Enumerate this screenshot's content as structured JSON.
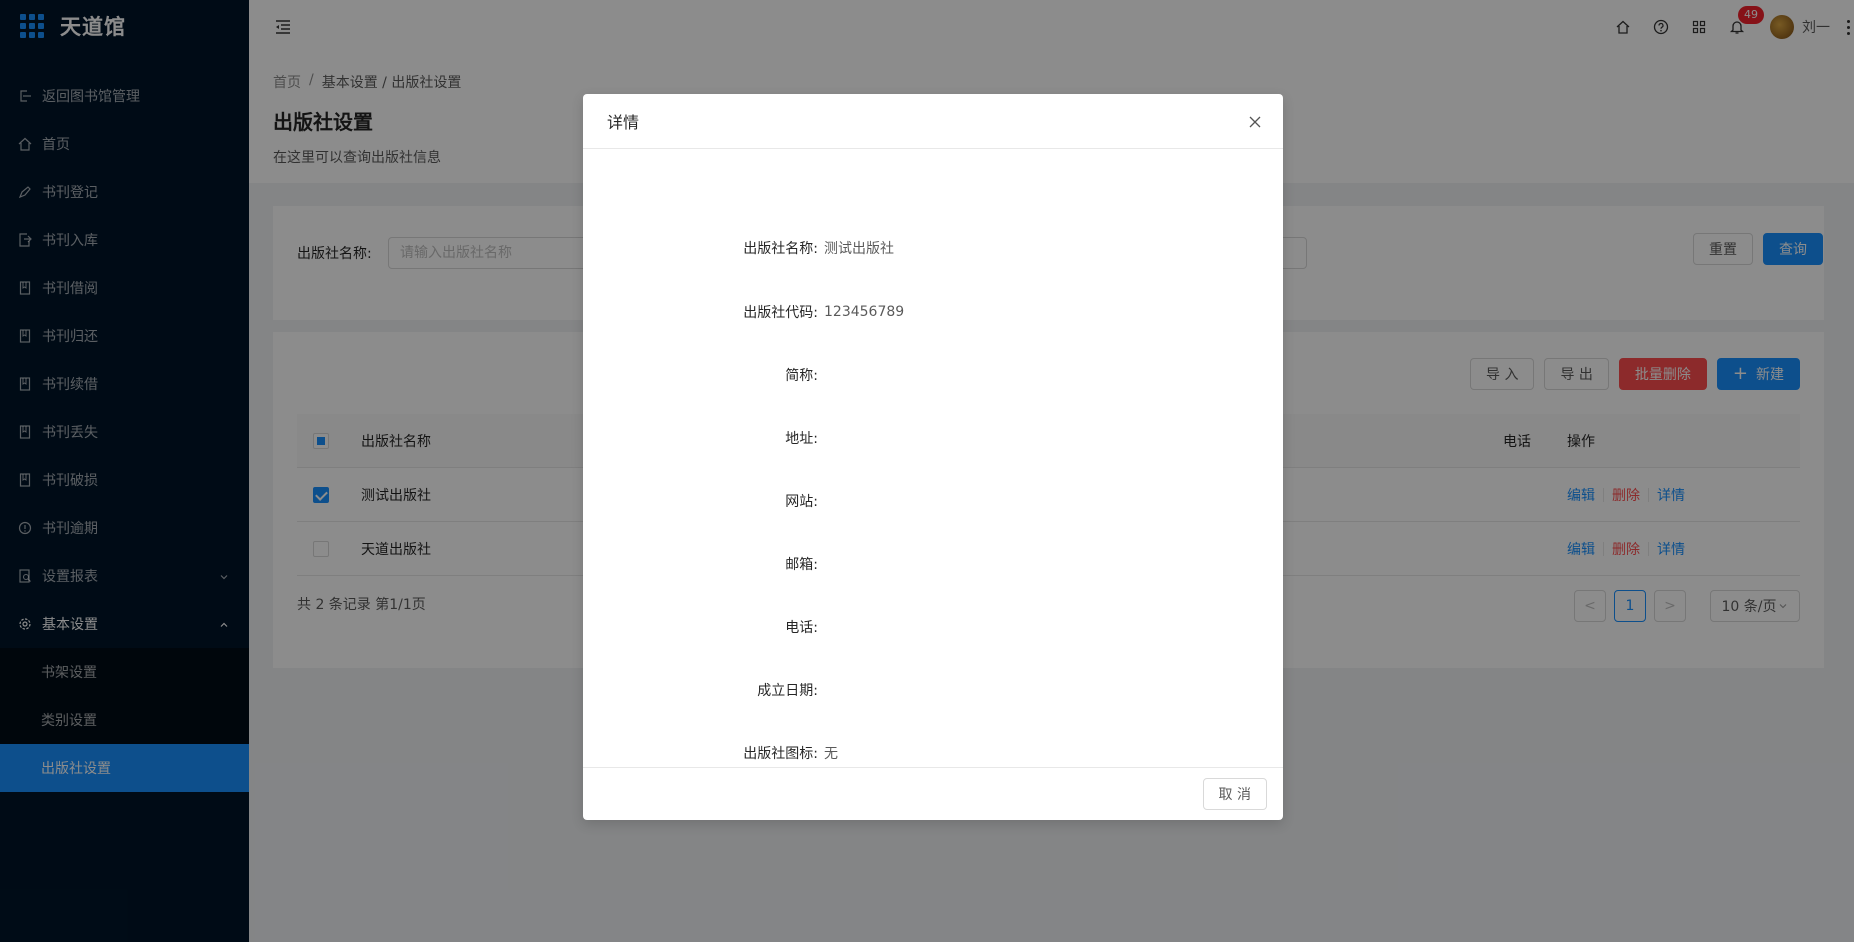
{
  "app": {
    "title": "天道馆"
  },
  "sidebar": {
    "items": [
      {
        "label": "返回图书馆管理",
        "icon": "return-icon"
      },
      {
        "label": "首页",
        "icon": "home-icon"
      },
      {
        "label": "书刊登记",
        "icon": "pen-icon"
      },
      {
        "label": "书刊入库",
        "icon": "import-icon"
      },
      {
        "label": "书刊借阅",
        "icon": "book-icon"
      },
      {
        "label": "书刊归还",
        "icon": "book-icon"
      },
      {
        "label": "书刊续借",
        "icon": "book-icon"
      },
      {
        "label": "书刊丢失",
        "icon": "book-icon"
      },
      {
        "label": "书刊破损",
        "icon": "book-icon"
      },
      {
        "label": "书刊逾期",
        "icon": "clock-icon"
      },
      {
        "label": "设置报表",
        "icon": "report-icon"
      },
      {
        "label": "基本设置",
        "icon": "gear-icon"
      }
    ],
    "submenu": [
      {
        "label": "书架设置"
      },
      {
        "label": "类别设置"
      },
      {
        "label": "出版社设置"
      }
    ]
  },
  "header": {
    "notification_count": "49",
    "user_name": "刘一"
  },
  "breadcrumb": {
    "home": "首页",
    "sep": "/",
    "current": "基本设置 / 出版社设置"
  },
  "page": {
    "title": "出版社设置",
    "description": "在这里可以查询出版社信息"
  },
  "search": {
    "label": "出版社名称:",
    "placeholder": "请输入出版社名称",
    "reset_label": "重置",
    "query_label": "查询"
  },
  "toolbar": {
    "import_label": "导 入",
    "export_label": "导 出",
    "batch_delete_label": "批量删除",
    "new_label": "新建"
  },
  "table": {
    "columns": {
      "name": "出版社名称",
      "phone": "电话",
      "ops": "操作"
    },
    "rows": [
      {
        "name": "测试出版社",
        "checked": true
      },
      {
        "name": "天道出版社",
        "checked": false
      }
    ],
    "actions": {
      "edit": "编辑",
      "delete": "删除",
      "detail": "详情"
    }
  },
  "pagination": {
    "total_text": "共 2 条记录 第1/1页",
    "prev": "<",
    "current": "1",
    "next": ">",
    "page_size": "10 条/页"
  },
  "modal": {
    "title": "详情",
    "fields": [
      {
        "label": "出版社名称:",
        "value": "测试出版社"
      },
      {
        "label": "出版社代码:",
        "value": "123456789"
      },
      {
        "label": "简称:",
        "value": ""
      },
      {
        "label": "地址:",
        "value": ""
      },
      {
        "label": "网站:",
        "value": ""
      },
      {
        "label": "邮箱:",
        "value": ""
      },
      {
        "label": "电话:",
        "value": ""
      },
      {
        "label": "成立日期:",
        "value": ""
      },
      {
        "label": "出版社图标:",
        "value": "无"
      }
    ],
    "cancel_label": "取 消"
  },
  "colors": {
    "primary": "#1890ff",
    "danger": "#ff4d4f",
    "sidebar_bg": "#001529"
  }
}
